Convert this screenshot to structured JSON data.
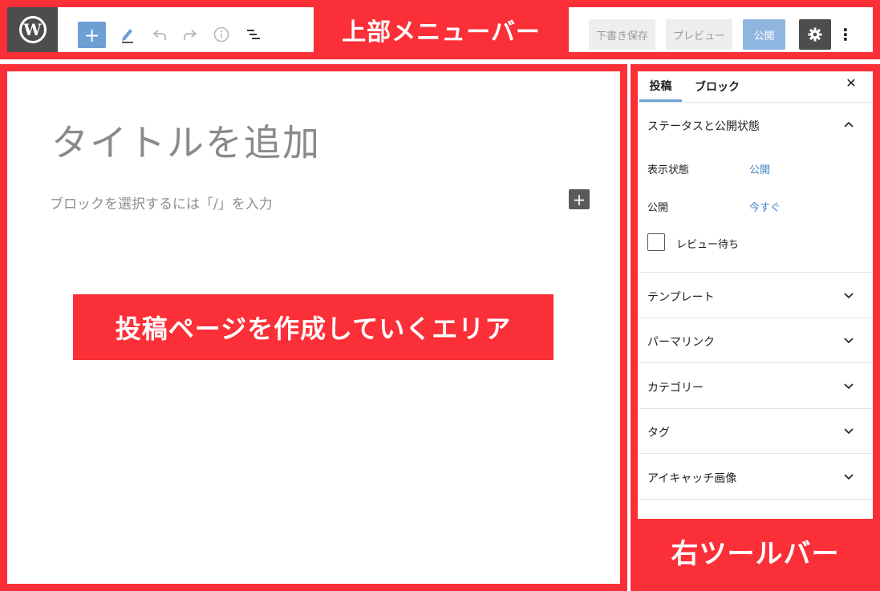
{
  "annotations": {
    "top_menu": "上部メニューバー",
    "editor_area": "投稿ページを作成していくエリア",
    "right_toolbar": "右ツールバー"
  },
  "header": {
    "logo_glyph": "W",
    "toolbar_icons": [
      "plus-icon",
      "pencil-icon",
      "undo-icon",
      "redo-icon",
      "info-icon",
      "list-view-icon"
    ],
    "draft_save_label": "下書き保存",
    "preview_label": "プレビュー",
    "publish_label": "公開"
  },
  "editor": {
    "title_placeholder": "タイトルを追加",
    "block_prompt": "ブロックを選択するには「/」を入力"
  },
  "sidebar": {
    "tabs": [
      {
        "label": "投稿",
        "active": true
      },
      {
        "label": "ブロック",
        "active": false
      }
    ],
    "status_panel": {
      "title": "ステータスと公開状態",
      "visibility_label": "表示状態",
      "visibility_value": "公開",
      "publish_label": "公開",
      "publish_value": "今すぐ",
      "pending_review_label": "レビュー待ち"
    },
    "panels": [
      {
        "title": "テンプレート"
      },
      {
        "title": "パーマリンク"
      },
      {
        "title": "カテゴリー"
      },
      {
        "title": "タグ"
      },
      {
        "title": "アイキャッチ画像"
      }
    ]
  },
  "colors": {
    "annotation_red": "#fb2f37",
    "accent_blue": "#6d9fd5",
    "link_blue": "#3b82c4",
    "dark_gray": "#4d4d4d"
  }
}
